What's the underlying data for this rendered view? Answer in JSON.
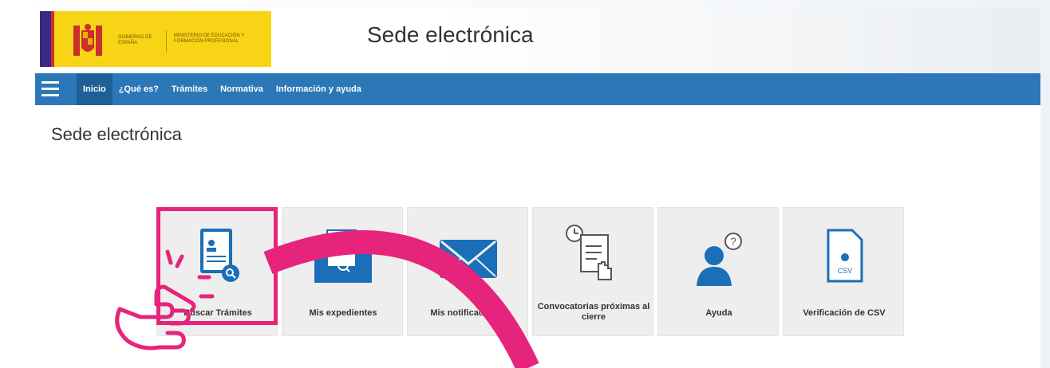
{
  "header": {
    "logo_line1": "GOBIERNO DE ESPAÑA",
    "logo_line2": "MINISTERIO DE EDUCACIÓN Y FORMACIÓN PROFESIONAL",
    "site_title": "Sede electrónica"
  },
  "nav": {
    "items": [
      {
        "label": "Inicio"
      },
      {
        "label": "¿Qué es?"
      },
      {
        "label": "Trámites"
      },
      {
        "label": "Normativa"
      },
      {
        "label": "Información y ayuda"
      }
    ]
  },
  "main": {
    "page_title": "Sede electrónica",
    "tiles": [
      {
        "label": "Buscar Trámites"
      },
      {
        "label": "Mis expedientes"
      },
      {
        "label": "Mis notificaciones"
      },
      {
        "label": "Convocatorias próximas al cierre"
      },
      {
        "label": "Ayuda"
      },
      {
        "label": "Verificación de CSV"
      }
    ],
    "csv_icon_text": "CSV"
  },
  "colors": {
    "nav_blue": "#2c77b8",
    "nav_active": "#1f5f97",
    "logo_yellow": "#f8d416",
    "icon_blue": "#1a6fb8",
    "highlight_pink": "#e6247b"
  }
}
